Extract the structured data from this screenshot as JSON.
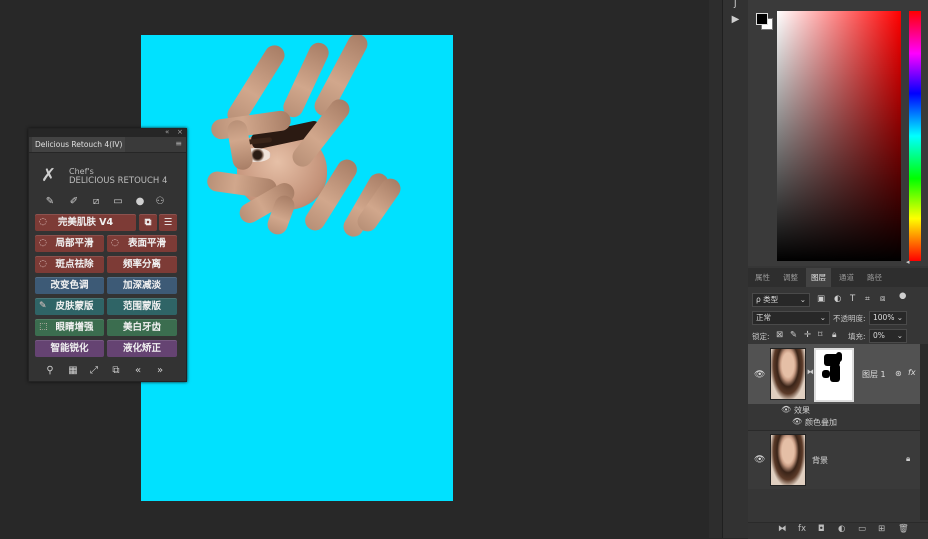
{
  "canvas": {
    "bg_color": "#00e1ff"
  },
  "retouch_panel": {
    "tab_title": "Delicious Retouch 4(IV)",
    "brand_line1": "Chef's",
    "brand_line2": "DELICIOUS RETOUCH 4",
    "tools": [
      "brush-icon",
      "pen-icon",
      "ruler-icon",
      "frame-icon",
      "person-icon",
      "person-plus-icon"
    ],
    "buttons": {
      "perfect_skin": "完美肌肤 V4",
      "local_smooth": "局部平滑",
      "surface_smooth": "表面平滑",
      "spot_removal": "斑点祛除",
      "freq_separation": "频率分离",
      "change_tone": "改变色调",
      "dodge_burn": "加深减淡",
      "skin_mask": "皮肤蒙版",
      "range_mask": "范围蒙版",
      "eye_enhance": "眼睛增强",
      "teeth_whiten": "美白牙齿",
      "smart_sharpen": "智能锐化",
      "liquify": "液化矫正"
    },
    "footer_icons": [
      "search-icon",
      "film-icon",
      "expand-icon",
      "duplicate-icon",
      "collapse-left-icon",
      "expand-right-icon"
    ]
  },
  "color_panel": {
    "foreground": "#000000",
    "background": "#ffffff",
    "hue": "#ff0000"
  },
  "layers_panel": {
    "tabs": [
      "属性",
      "调整",
      "图层",
      "通道",
      "路径"
    ],
    "active_tab": "图层",
    "filter_kind": "ρ 类型",
    "blend_mode": "正常",
    "opacity_label": "不透明度:",
    "opacity_value": "100%",
    "lock_label": "锁定:",
    "fill_label": "填充:",
    "fill_value": "0%",
    "layers": [
      {
        "name": "图层 1",
        "fx": "fx",
        "effects_label": "效果",
        "effect_item": "颜色叠加"
      },
      {
        "name": "背景"
      }
    ]
  }
}
